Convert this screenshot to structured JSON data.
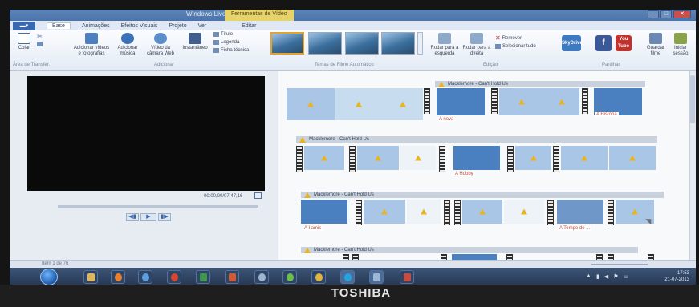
{
  "window": {
    "title": "Windows Live Movie Maker",
    "context_tab": "Ferramentas de Vídeo",
    "controls": [
      "–",
      "□",
      "✕"
    ]
  },
  "tabs": {
    "file": "▬▾",
    "items": [
      "Base",
      "Animações",
      "Efeitos Visuais",
      "Projeto",
      "Ver",
      "Editar"
    ]
  },
  "ribbon": {
    "paste": "Colar",
    "add_video": "Adicionar vídeos e fotografias",
    "add_music": "Adicionar música",
    "webcam": "Vídeo da câmara Web",
    "snapshot": "Instantâneo",
    "title": "Título",
    "caption": "Legenda",
    "credits": "Ficha técnica",
    "group_clipboard": "Área de Transfer.",
    "group_add": "Adicionar",
    "group_themes": "Temas de Filme Automático",
    "rotate_left": "Rodar para a esquerda",
    "rotate_right": "Rodar para a direita",
    "remove": "Remover",
    "select_all": "Selecionar tudo",
    "group_edit": "Edição",
    "skydrive": "SkyDrive",
    "facebook": "f",
    "youtube": "You Tube",
    "save_movie": "Guardar filme",
    "sign_in": "Iniciar sessão",
    "group_share": "Partilhar"
  },
  "preview": {
    "timecode": "00:00,00/07:47,16"
  },
  "storyboard": {
    "music_label": "Macklemore - Can't Hold Us",
    "captions": [
      "A nova",
      "A História",
      "A Hobby",
      "A I amis",
      "A Tempo de ..."
    ]
  },
  "status": {
    "text": "Item 1 de 76"
  },
  "taskbar": {
    "time": "17:53",
    "date": "21-07-2013"
  },
  "monitor": {
    "brand": "TOSHIBA"
  },
  "colors": {
    "accent": "#3a68b0",
    "warning": "#e8b520",
    "clip_blue": "#4a7fc0"
  }
}
